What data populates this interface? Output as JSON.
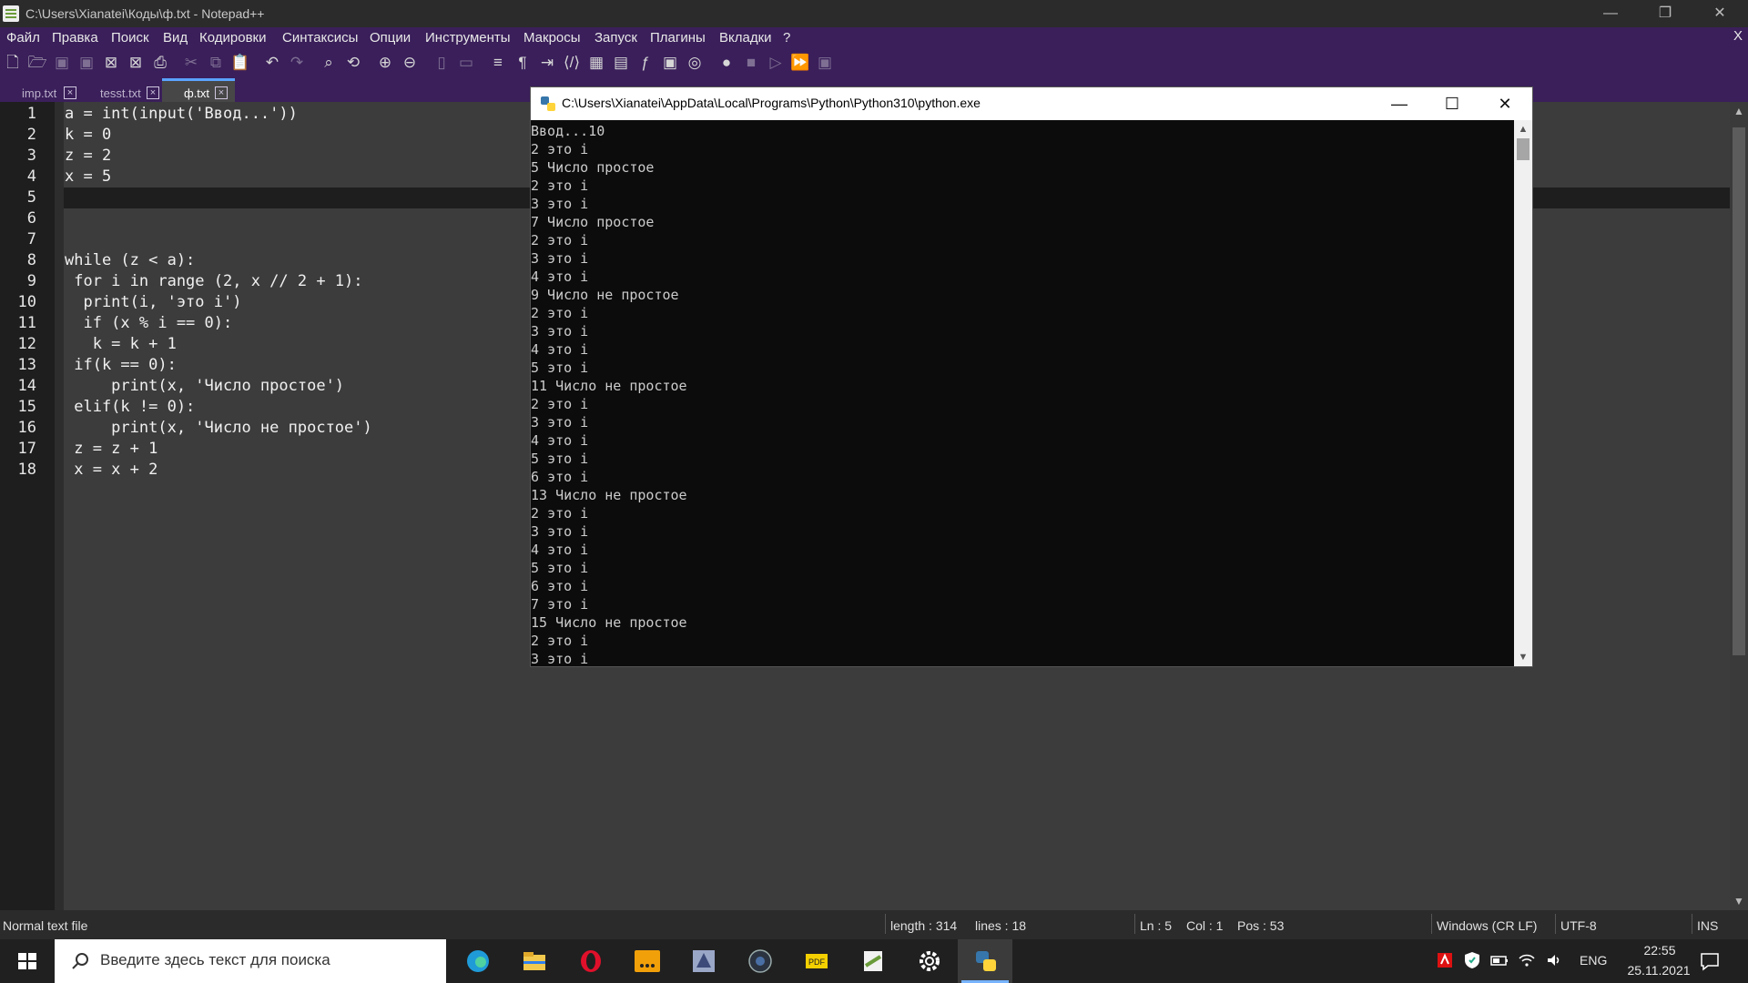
{
  "window": {
    "title": "C:\\Users\\Xianatei\\Коды\\ф.txt - Notepad++",
    "minimize": "—",
    "restore": "❐",
    "close": "✕"
  },
  "menu": {
    "items": [
      "Файл",
      "Правка",
      "Поиск",
      "Вид",
      "Кодировки",
      "Синтаксисы",
      "Опции",
      "Инструменты",
      "Макросы",
      "Запуск",
      "Плагины",
      "Вкладки",
      "?"
    ],
    "close": "X"
  },
  "toolbar": {
    "icons": [
      "new-file-icon",
      "open-file-icon",
      "save-icon",
      "save-all-icon",
      "close-icon",
      "close-all-icon",
      "print-icon",
      "cut-icon",
      "copy-icon",
      "paste-icon",
      "undo-icon",
      "redo-icon",
      "find-icon",
      "replace-icon",
      "zoom-in-icon",
      "zoom-out-icon",
      "sync-v-icon",
      "sync-h-icon",
      "word-wrap-icon",
      "show-all-chars-icon",
      "indent-guide-icon",
      "xml-tag-icon",
      "document-map-icon",
      "document-list-icon",
      "function-list-icon",
      "folder-workspace-icon",
      "monitoring-icon",
      "record-macro-icon",
      "stop-record-icon",
      "play-macro-icon",
      "run-macro-multiple-icon",
      "save-macro-icon"
    ]
  },
  "tabs": [
    {
      "label": "imp.txt",
      "close": "×",
      "active": false
    },
    {
      "label": "tesst.txt",
      "close": "×",
      "active": false
    },
    {
      "label": "ф.txt",
      "close": "×",
      "active": true
    }
  ],
  "editor": {
    "lines": [
      {
        "n": "1",
        "text": "a = int(input('Ввод...'))"
      },
      {
        "n": "2",
        "text": "k = 0"
      },
      {
        "n": "3",
        "text": "z = 2"
      },
      {
        "n": "4",
        "text": "x = 5"
      },
      {
        "n": "5",
        "text": ""
      },
      {
        "n": "6",
        "text": ""
      },
      {
        "n": "7",
        "text": ""
      },
      {
        "n": "8",
        "text": "while (z < a):"
      },
      {
        "n": "9",
        "text": " for i in range (2, x // 2 + 1):"
      },
      {
        "n": "10",
        "text": "  print(i, 'это i')"
      },
      {
        "n": "11",
        "text": "  if (x % i == 0):"
      },
      {
        "n": "12",
        "text": "   k = k + 1"
      },
      {
        "n": "13",
        "text": " if(k == 0):"
      },
      {
        "n": "14",
        "text": "     print(x, 'Число простое')"
      },
      {
        "n": "15",
        "text": " elif(k != 0):"
      },
      {
        "n": "16",
        "text": "     print(x, 'Число не простое')"
      },
      {
        "n": "17",
        "text": " z = z + 1"
      },
      {
        "n": "18",
        "text": " x = x + 2"
      }
    ]
  },
  "console": {
    "title": "C:\\Users\\Xianatei\\AppData\\Local\\Programs\\Python\\Python310\\python.exe",
    "minimize": "—",
    "maximize": "☐",
    "close": "✕",
    "output": "Ввод...10\n2 это i\n5 Число простое\n2 это i\n3 это i\n7 Число простое\n2 это i\n3 это i\n4 это i\n9 Число не простое\n2 это i\n3 это i\n4 это i\n5 это i\n11 Число не простое\n2 это i\n3 это i\n4 это i\n5 это i\n6 это i\n13 Число не простое\n2 это i\n3 это i\n4 это i\n5 это i\n6 это i\n7 это i\n15 Число не простое\n2 это i\n3 это i"
  },
  "status": {
    "file_type": "Normal text file",
    "length": "length : 314",
    "lines": "lines : 18",
    "ln": "Ln : 5",
    "col": "Col : 1",
    "pos": "Pos : 53",
    "eol": "Windows (CR LF)",
    "encoding": "UTF-8",
    "mode": "INS"
  },
  "taskbar": {
    "search_placeholder": "Введите здесь текст для поиска",
    "apps": [
      "edge-icon",
      "file-explorer-icon",
      "opera-icon",
      "ellipsis-app-icon",
      "game-app-icon",
      "browser-globe-icon",
      "pdf-app-icon",
      "notepadpp-icon",
      "settings-gear-icon",
      "python-icon"
    ],
    "language": "ENG",
    "time": "22:55",
    "date": "25.11.2021"
  },
  "colors": {
    "menu_bg": "#3a1f5a",
    "editor_bg": "#3c3c3c",
    "tab_accent": "#5aa3ff",
    "console_bg": "#0c0c0c"
  }
}
